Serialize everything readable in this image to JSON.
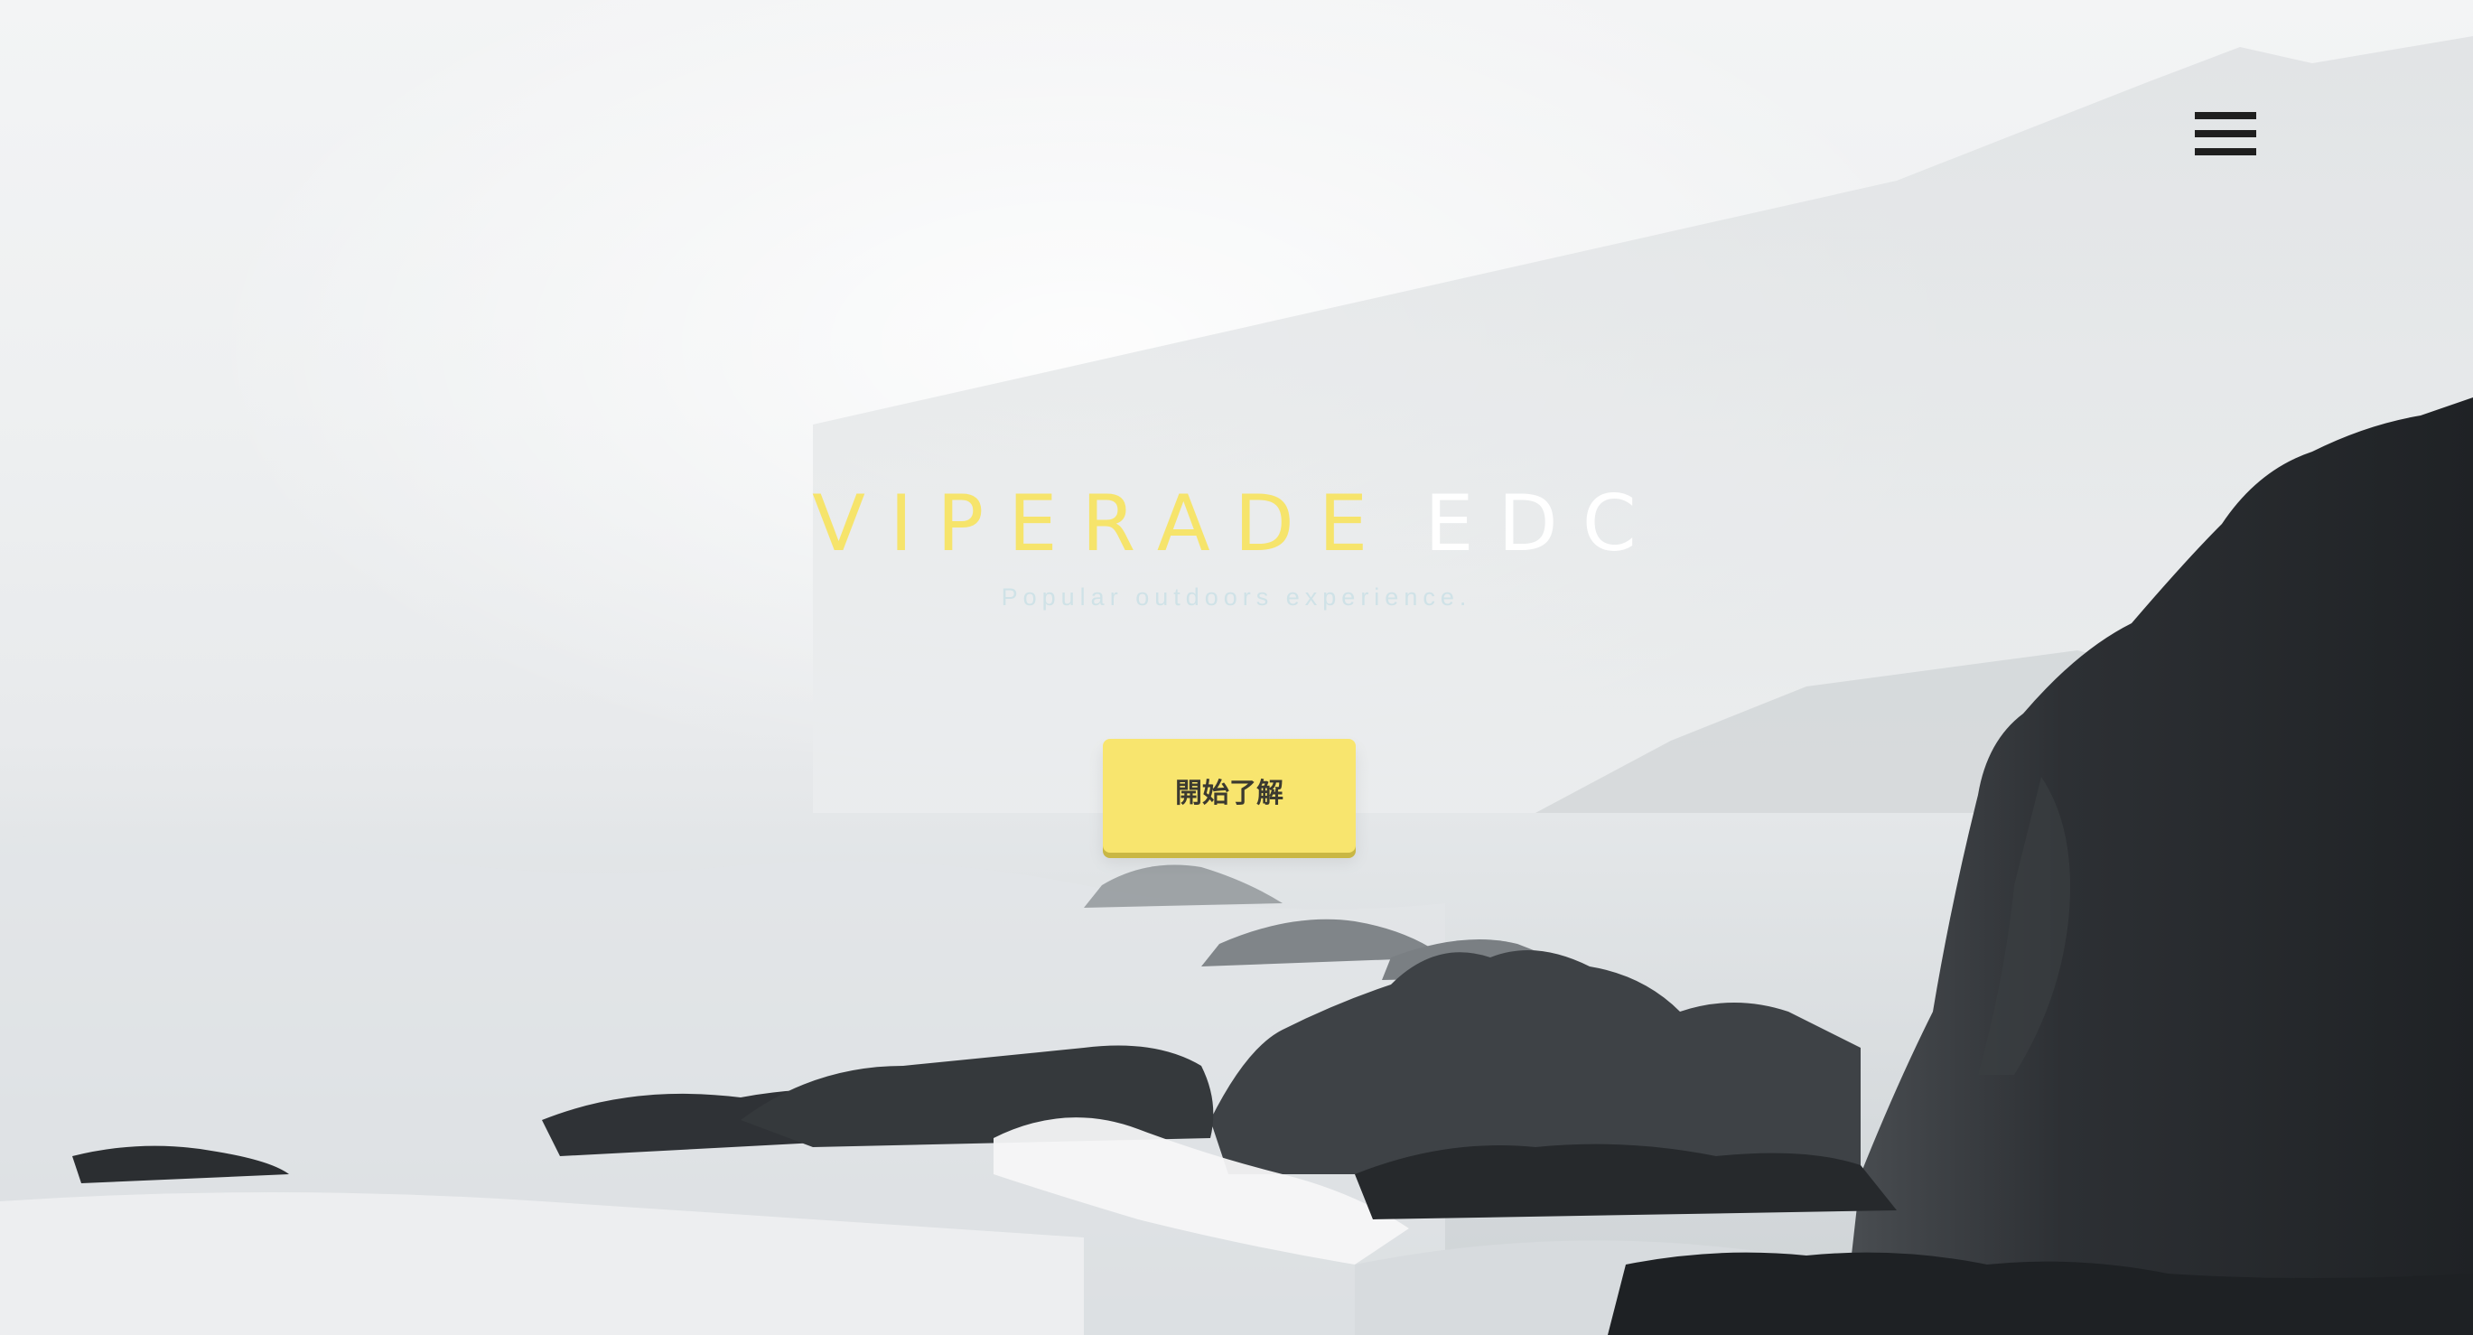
{
  "hero": {
    "title_part1": "VIPERADE",
    "title_part2": "EDC",
    "subtitle": "Popular outdoors experience.",
    "cta_label": "開始了解"
  },
  "nav": {
    "menu_icon": "hamburger-menu-icon"
  },
  "colors": {
    "accent_yellow": "#f8e56e",
    "title_yellow": "#f6e46b",
    "title_white": "#ffffff",
    "subtitle": "#cfe2e7",
    "menu_icon": "#1f1f1f"
  }
}
